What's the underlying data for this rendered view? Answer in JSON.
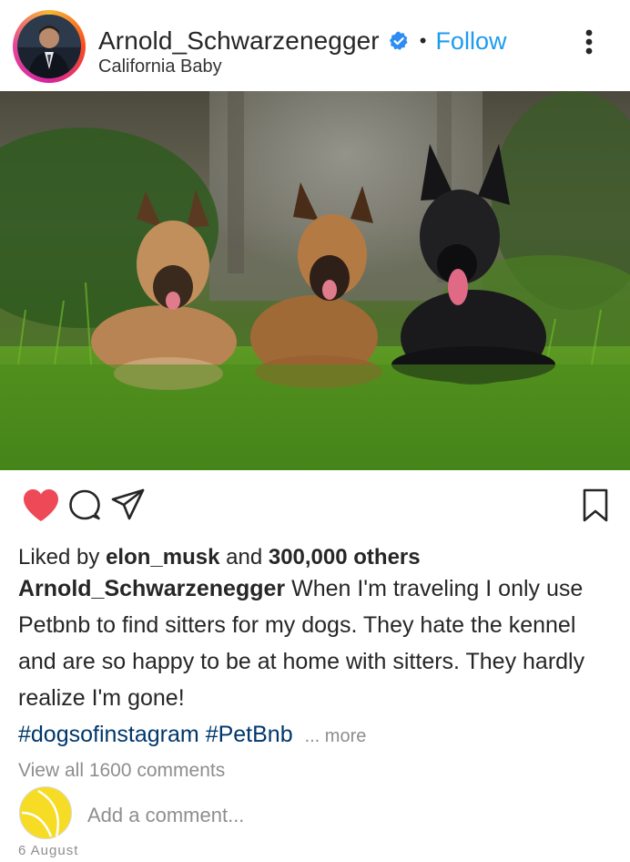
{
  "post": {
    "username": "Arnold_Schwarzenegger",
    "location": "California Baby",
    "follow_label": "Follow",
    "separator": "•",
    "likes": {
      "prefix": "Liked by",
      "user": "elon_musk",
      "joiner": "and",
      "others": "300,000 others",
      "liked": true
    },
    "caption": {
      "user": "Arnold_Schwarzenegger",
      "text": "When I'm traveling I only use Petbnb to find sitters for my dogs. They hate the kennel and are so happy to be at home with sitters. They hardly realize I'm gone!"
    },
    "hashtags": [
      "#dogsofinstagram",
      "#PetBnb"
    ],
    "more_label": "... more",
    "view_all_comments": "View all 1600 comments",
    "add_comment_placeholder": "Add a comment...",
    "date": "6 August"
  },
  "icons": {
    "verified": "verified-badge-icon",
    "more": "vertical-dots-icon",
    "like": "heart-icon",
    "comment": "comment-bubble-icon",
    "share": "paper-plane-icon",
    "save": "bookmark-icon"
  },
  "colors": {
    "follow": "#1d9bf0",
    "heart": "#ed4956",
    "hashtag": "#00376b",
    "muted": "#8e8e8e",
    "comment_avatar": "#f7dc26"
  }
}
